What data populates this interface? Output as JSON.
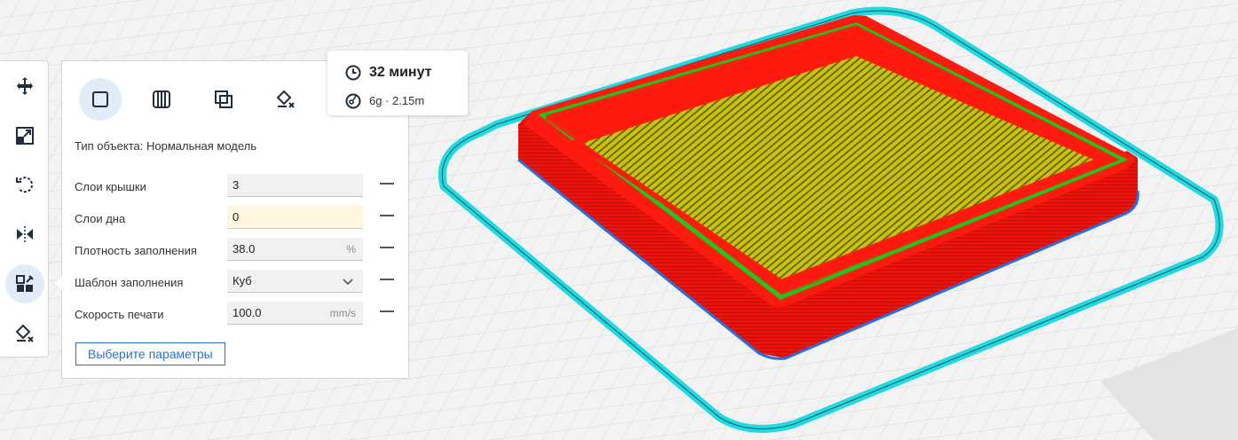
{
  "toolbar": {
    "tools": [
      {
        "icon": "move-icon",
        "active": false
      },
      {
        "icon": "scale-icon",
        "active": false
      },
      {
        "icon": "rotate-icon",
        "active": false
      },
      {
        "icon": "mirror-icon",
        "active": false
      },
      {
        "icon": "per-model-settings-icon",
        "active": true
      },
      {
        "icon": "support-blocker-icon",
        "active": false
      }
    ]
  },
  "panel": {
    "mesh_types": [
      {
        "icon": "normal-model-icon",
        "active": true
      },
      {
        "icon": "infill-mesh-icon",
        "active": false
      },
      {
        "icon": "overlap-icon",
        "active": false
      },
      {
        "icon": "support-blocker-type-icon",
        "active": false
      }
    ],
    "object_type": "Тип объекта: Нормальная модель",
    "settings": [
      {
        "label": "Слои крышки",
        "value": "3",
        "unit": ""
      },
      {
        "label": "Слои дна",
        "value": "0",
        "unit": ""
      },
      {
        "label": "Плотность заполнения",
        "value": "38.0",
        "unit": "%"
      },
      {
        "label": "Шаблон заполнения",
        "value": "Куб",
        "unit": ""
      },
      {
        "label": "Скорость печати",
        "value": "100.0",
        "unit": "mm/s"
      }
    ],
    "select_button": "Выберите параметры"
  },
  "estimate": {
    "time": "32 минут",
    "material": "6g · 2.15m"
  },
  "colors": {
    "accent": "#2a72c6",
    "wall": "#ff1a0f",
    "inner_wall": "#22c51e",
    "infill": "#c9c20f",
    "skirt": "#23d8e0"
  }
}
